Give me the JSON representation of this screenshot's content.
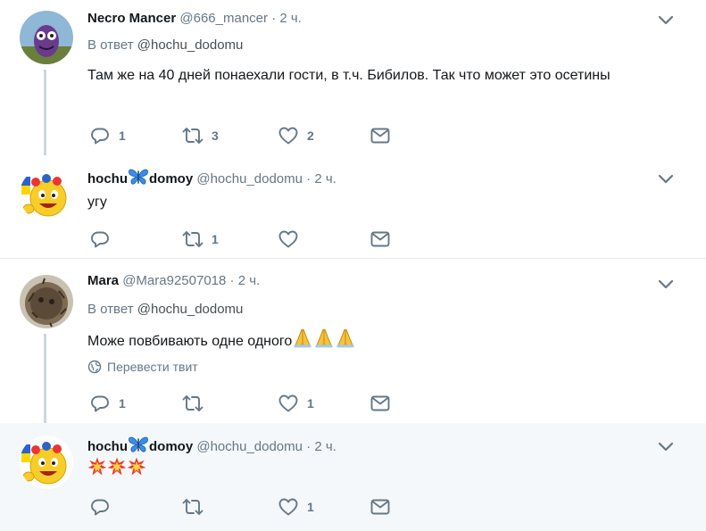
{
  "colors": {
    "text": "#14171a",
    "meta": "#657786",
    "divider": "#e6ecf0",
    "thread_line": "#ccd6dd",
    "highlight_bg": "#f5f8fa"
  },
  "tweets": [
    {
      "name": "Necro Mancer",
      "handle": "@666_mancer",
      "time": "2 ч.",
      "reply_prefix": "В ответ",
      "reply_to": "@hochu_dodomu",
      "text": "Там же на 40 дней понаехали гости, в т.ч. Бибилов. Так что может это осетины",
      "replies": "1",
      "retweets": "3",
      "likes": "2"
    },
    {
      "name_part1": "hochu",
      "name_part2": "domoy",
      "handle": "@hochu_dodomu",
      "time": "2 ч.",
      "text": "угу",
      "replies": "",
      "retweets": "1",
      "likes": ""
    },
    {
      "name": "Mara",
      "handle": "@Mara92507018",
      "time": "2 ч.",
      "reply_prefix": "В ответ",
      "reply_to": "@hochu_dodomu",
      "text": "Може повбивають одне одного",
      "translate": "Перевести твит",
      "replies": "1",
      "retweets": "",
      "likes": "1"
    },
    {
      "name_part1": "hochu",
      "name_part2": "domoy",
      "handle": "@hochu_dodomu",
      "time": "2 ч.",
      "text": "",
      "replies": "",
      "retweets": "",
      "likes": "1"
    }
  ],
  "separator": "·",
  "icons": [
    "chevron-down-icon",
    "reply-icon",
    "retweet-icon",
    "like-icon",
    "message-icon",
    "globe-icon",
    "butterfly-icon",
    "praying-hands-icon",
    "collision-icon"
  ]
}
